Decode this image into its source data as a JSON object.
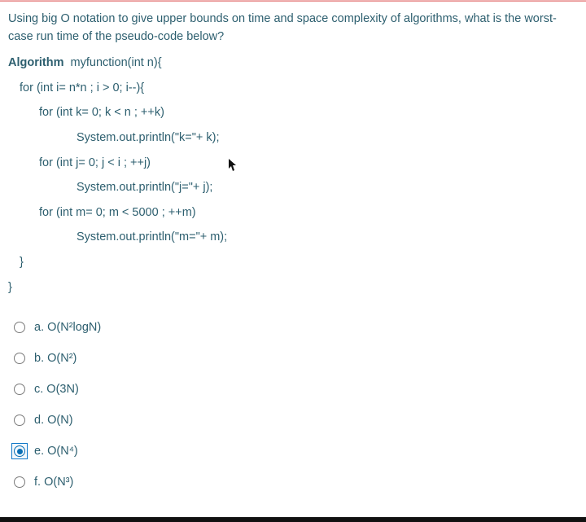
{
  "question": {
    "prompt": "Using big O notation to give upper bounds on time and space complexity of algorithms, what is the worst-case run time of the pseudo-code below?",
    "code": {
      "l1a": "Algorithm",
      "l1b": "  myfunction(int n){",
      "l2": "for (int i= n*n ; i > 0; i--){",
      "l3": "for (int k= 0; k < n ; ++k)",
      "l4": "System.out.println(\"k=\"+ k);",
      "l5": "for (int j= 0; j < i ; ++j)",
      "l6": "System.out.println(\"j=\"+ j);",
      "l7": "for (int m= 0; m < 5000 ; ++m)",
      "l8": "System.out.println(\"m=\"+ m);",
      "l9": "}",
      "l10": "}"
    }
  },
  "options": {
    "a": "a. O(N²logN)",
    "b": "b. O(N²)",
    "c": "c. O(3N)",
    "d": "d. O(N)",
    "e": "e. O(N⁴)",
    "f": "f. O(N³)"
  },
  "selected": "e"
}
